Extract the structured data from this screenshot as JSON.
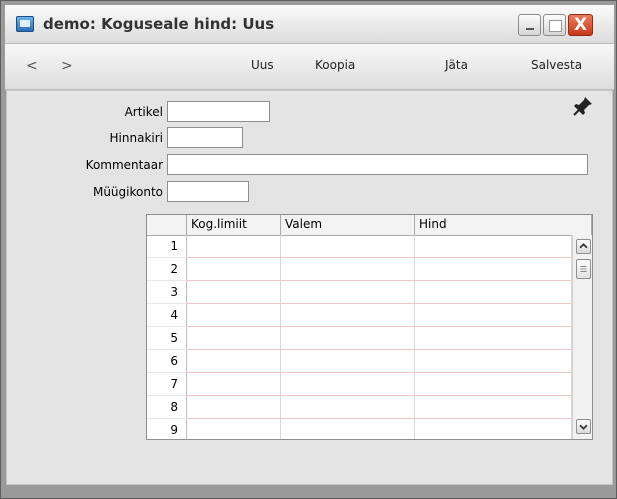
{
  "window": {
    "title": "demo: Koguseale hind: Uus",
    "close_glyph": "X"
  },
  "toolbar": {
    "prev_glyph": "<",
    "next_glyph": ">",
    "uus_label": "Uus",
    "koopia_label": "Koopia",
    "jata_label": "Jäta",
    "salvesta_label": "Salvesta"
  },
  "form": {
    "artikel_label": "Artikel",
    "artikel_value": "",
    "hinnakiri_label": "Hinnakiri",
    "hinnakiri_value": "",
    "kommentaar_label": "Kommentaar",
    "kommentaar_value": "",
    "myygikonto_label": "Müügikonto",
    "myygikonto_value": ""
  },
  "grid": {
    "columns": [
      "Kog.limiit",
      "Valem",
      "Hind"
    ],
    "rows": [
      "1",
      "2",
      "3",
      "4",
      "5",
      "6",
      "7",
      "8",
      "9"
    ]
  },
  "icons": {
    "pin": "pin-icon",
    "app": "app-icon"
  }
}
